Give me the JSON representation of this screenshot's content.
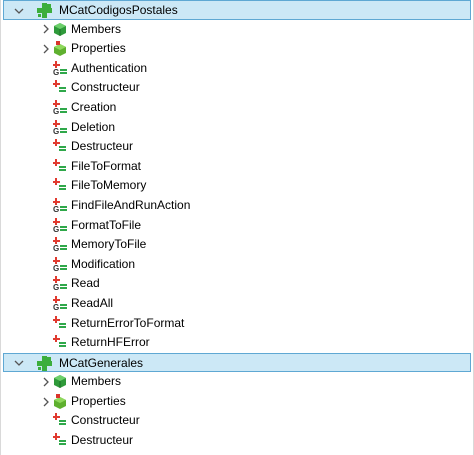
{
  "tree": {
    "classes": [
      {
        "name": "MCatCodigosPostales",
        "groups": [
          "Members",
          "Properties"
        ],
        "methods": [
          {
            "label": "Authentication",
            "icon": "method-event-icon"
          },
          {
            "label": "Constructeur",
            "icon": "method-icon"
          },
          {
            "label": "Creation",
            "icon": "method-event-icon"
          },
          {
            "label": "Deletion",
            "icon": "method-event-icon"
          },
          {
            "label": "Destructeur",
            "icon": "method-icon"
          },
          {
            "label": "FileToFormat",
            "icon": "method-icon"
          },
          {
            "label": "FileToMemory",
            "icon": "method-icon"
          },
          {
            "label": "FindFileAndRunAction",
            "icon": "method-event-icon"
          },
          {
            "label": "FormatToFile",
            "icon": "method-event-icon"
          },
          {
            "label": "MemoryToFile",
            "icon": "method-event-icon"
          },
          {
            "label": "Modification",
            "icon": "method-event-icon"
          },
          {
            "label": "Read",
            "icon": "method-event-icon"
          },
          {
            "label": "ReadAll",
            "icon": "method-event-icon"
          },
          {
            "label": "ReturnErrorToFormat",
            "icon": "method-icon"
          },
          {
            "label": "ReturnHFError",
            "icon": "method-icon"
          }
        ]
      },
      {
        "name": "MCatGenerales",
        "groups": [
          "Members",
          "Properties"
        ],
        "methods": [
          {
            "label": "Constructeur",
            "icon": "method-icon"
          },
          {
            "label": "Destructeur",
            "icon": "method-icon"
          }
        ]
      }
    ]
  },
  "colors": {
    "selection_bg": "#cce8f6",
    "selection_border": "#5fa8d3",
    "class_green": "#3cae3c",
    "member_green": "#2f9a3a",
    "property_green": "#5fb02f",
    "property_red": "#d9342b",
    "method_red": "#e03a2f",
    "method_green": "#2fa84a"
  }
}
